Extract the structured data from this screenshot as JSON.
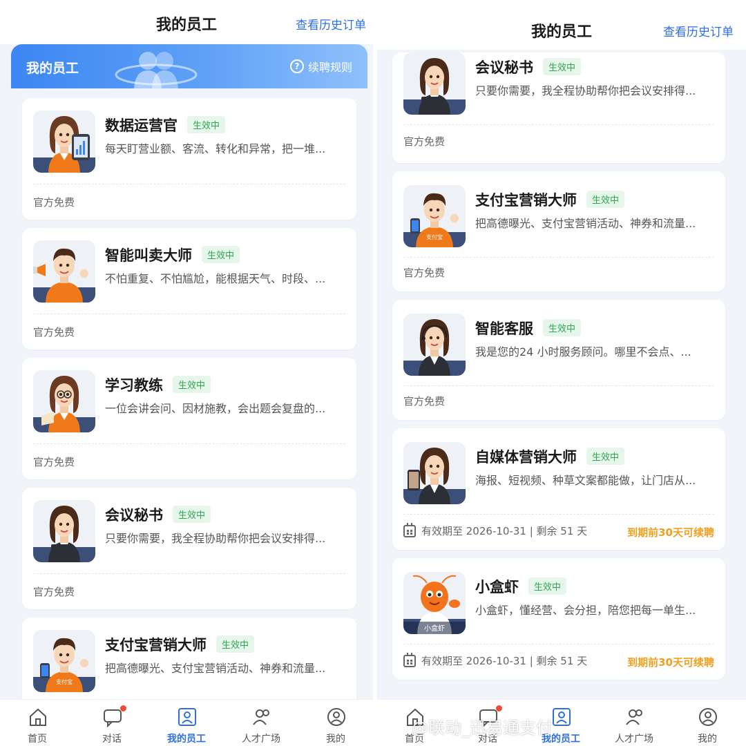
{
  "left": {
    "header": {
      "title": "我的员工",
      "history_link": "查看历史订单"
    },
    "banner": {
      "title": "我的员工",
      "help_icon": "?",
      "rules_label": "续聘规则"
    },
    "cards": [
      {
        "name": "数据运营官",
        "status": "生效中",
        "desc": "每天盯营业额、客流、转化和异常，把一堆...",
        "footer": "官方免费"
      },
      {
        "name": "智能叫卖大师",
        "status": "生效中",
        "desc": "不怕重复、不怕尴尬，能根据天气、时段、...",
        "footer": "官方免费"
      },
      {
        "name": "学习教练",
        "status": "生效中",
        "desc": "一位会讲会问、因材施教，会出题会复盘的...",
        "footer": "官方免费"
      },
      {
        "name": "会议秘书",
        "status": "生效中",
        "desc": "只要你需要，我全程协助帮你把会议安排得...",
        "footer": "官方免费"
      },
      {
        "name": "支付宝营销大师",
        "status": "生效中",
        "desc": "把高德曝光、支付宝营销活动、神券和流量..."
      }
    ]
  },
  "right": {
    "header": {
      "title": "我的员工",
      "history_link": "查看历史订单"
    },
    "cards": [
      {
        "name": "会议秘书",
        "status": "生效中",
        "desc": "只要你需要，我全程协助帮你把会议安排得...",
        "footer": "官方免费"
      },
      {
        "name": "支付宝营销大师",
        "status": "生效中",
        "desc": "把高德曝光、支付宝营销活动、神券和流量...",
        "footer": "官方免费"
      },
      {
        "name": "智能客服",
        "status": "生效中",
        "desc": "我是您的24 小时服务顾问。哪里不会点、...",
        "footer": "官方免费"
      },
      {
        "name": "自媒体营销大师",
        "status": "生效中",
        "desc": "海报、短视频、种草文案都能做，让门店从...",
        "validity": "有效期至 2026-10-31 | 剩余 51 天",
        "renew_tip": "到期前30天可续聘"
      },
      {
        "name": "小盒虾",
        "status": "生效中",
        "desc": "小盒虾，懂经营、会分担，陪您把每一单生...",
        "validity": "有效期至 2026-10-31 | 剩余 51 天",
        "renew_tip": "到期前30天可续聘",
        "avatar_caption": "小盒虾"
      }
    ]
  },
  "avatar_badges": {
    "alipay_shirt": "支付宝"
  },
  "tabbar": [
    {
      "label": "首页",
      "icon": "home-icon"
    },
    {
      "label": "对话",
      "icon": "chat-icon",
      "dot": true
    },
    {
      "label": "我的员工",
      "icon": "staff-icon",
      "active": true
    },
    {
      "label": "人才广场",
      "icon": "talent-icon"
    },
    {
      "label": "我的",
      "icon": "profile-icon"
    }
  ],
  "watermark": "@联动_迅易通支付",
  "colors": {
    "accent": "#2f6fe0",
    "status_green": "#2fa553",
    "renew_orange": "#f0a020",
    "avatar_orange": "#f07a1a"
  }
}
